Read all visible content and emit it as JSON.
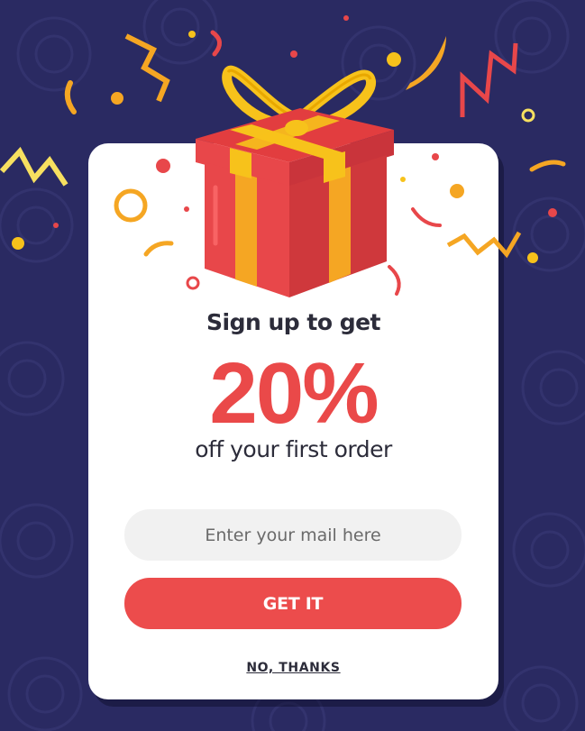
{
  "popup": {
    "headline": "Sign up to get",
    "discount": "20%",
    "subline": "off your first order",
    "email_placeholder": "Enter your mail here",
    "email_value": "",
    "cta_label": "GET IT",
    "decline_label": "NO, THANKS"
  },
  "colors": {
    "background": "#2a2a62",
    "card": "#ffffff",
    "accent_red": "#ec4c4c",
    "discount_red": "#ea4949",
    "gift_red": "#e8474a",
    "ribbon_yellow": "#f7c21b",
    "ribbon_orange": "#f5a623",
    "input_bg": "#f1f1f1",
    "text_dark": "#2c2c3a"
  },
  "icons": {
    "gift": "gift-box-icon",
    "confetti": "confetti-decoration"
  }
}
